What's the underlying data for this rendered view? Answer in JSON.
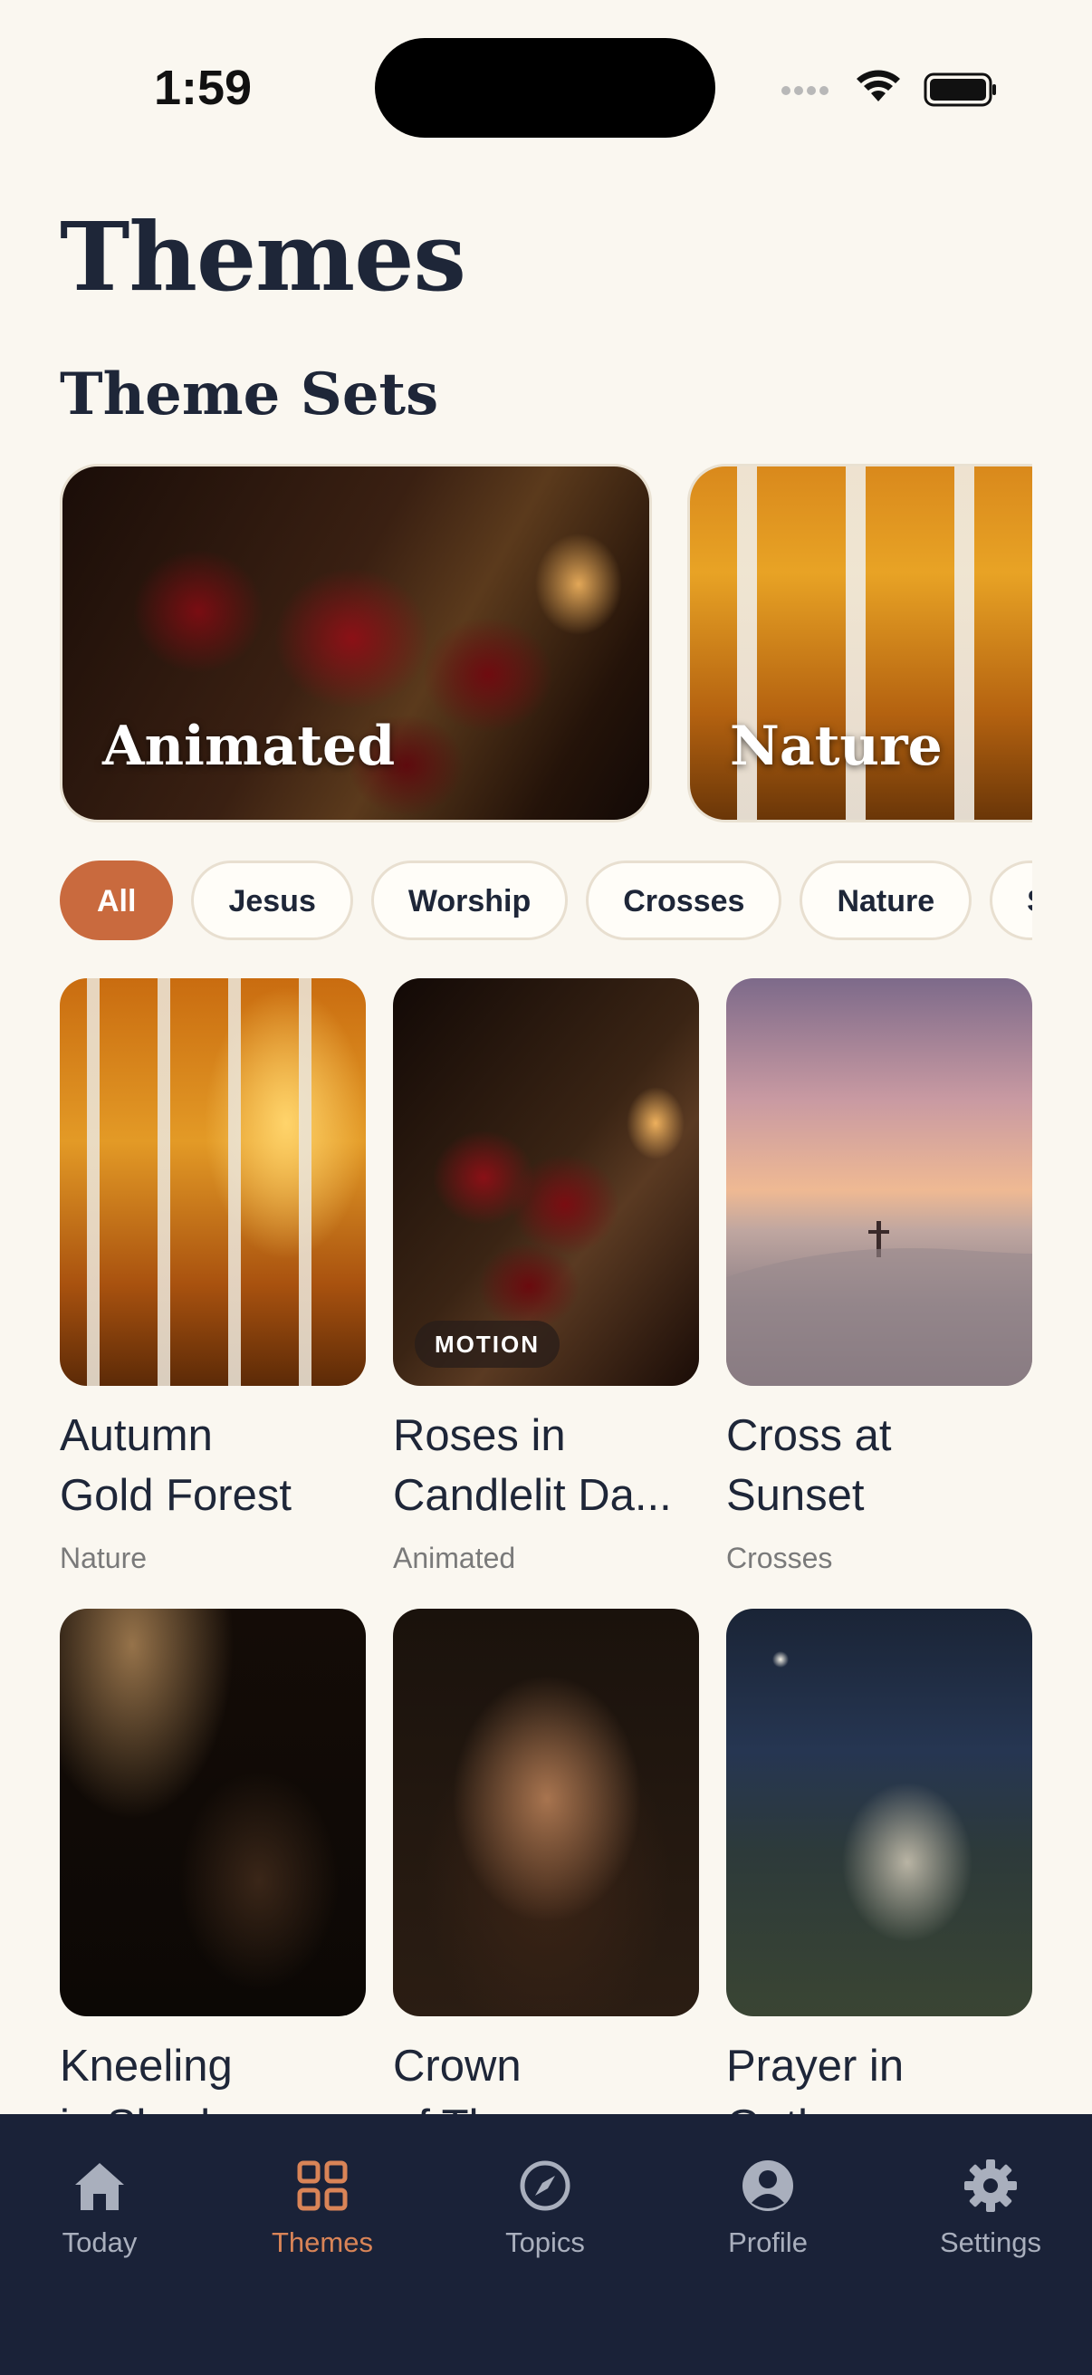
{
  "status_bar": {
    "time": "1:59"
  },
  "page": {
    "title": "Themes"
  },
  "theme_sets": {
    "title": "Theme Sets",
    "items": [
      {
        "label": "Animated"
      },
      {
        "label": "Nature"
      }
    ]
  },
  "filters": {
    "selected": "All",
    "chips": [
      "All",
      "Jesus",
      "Worship",
      "Crosses",
      "Nature",
      "Su"
    ]
  },
  "themes": [
    {
      "title": "Autumn\nGold Forest",
      "category": "Nature"
    },
    {
      "title": "Roses in\nCandlelit Da...",
      "category": "Animated",
      "badge": "MOTION"
    },
    {
      "title": "Cross at\nSunset",
      "category": "Crosses"
    },
    {
      "title": "Kneeling\nin Shadow",
      "category": ""
    },
    {
      "title": "Crown\nof Thorns",
      "category": ""
    },
    {
      "title": "Prayer in\nGethsemane",
      "category": ""
    }
  ],
  "tabbar": {
    "active": "Themes",
    "items": [
      {
        "label": "Today",
        "icon": "home-icon"
      },
      {
        "label": "Themes",
        "icon": "grid-icon"
      },
      {
        "label": "Topics",
        "icon": "compass-icon"
      },
      {
        "label": "Profile",
        "icon": "person-icon"
      },
      {
        "label": "Settings",
        "icon": "gear-icon"
      }
    ]
  },
  "colors": {
    "background": "#faf7f0",
    "accent": "#c96a3e",
    "tabbar": "#1a2238",
    "title_text": "#1e2638"
  }
}
